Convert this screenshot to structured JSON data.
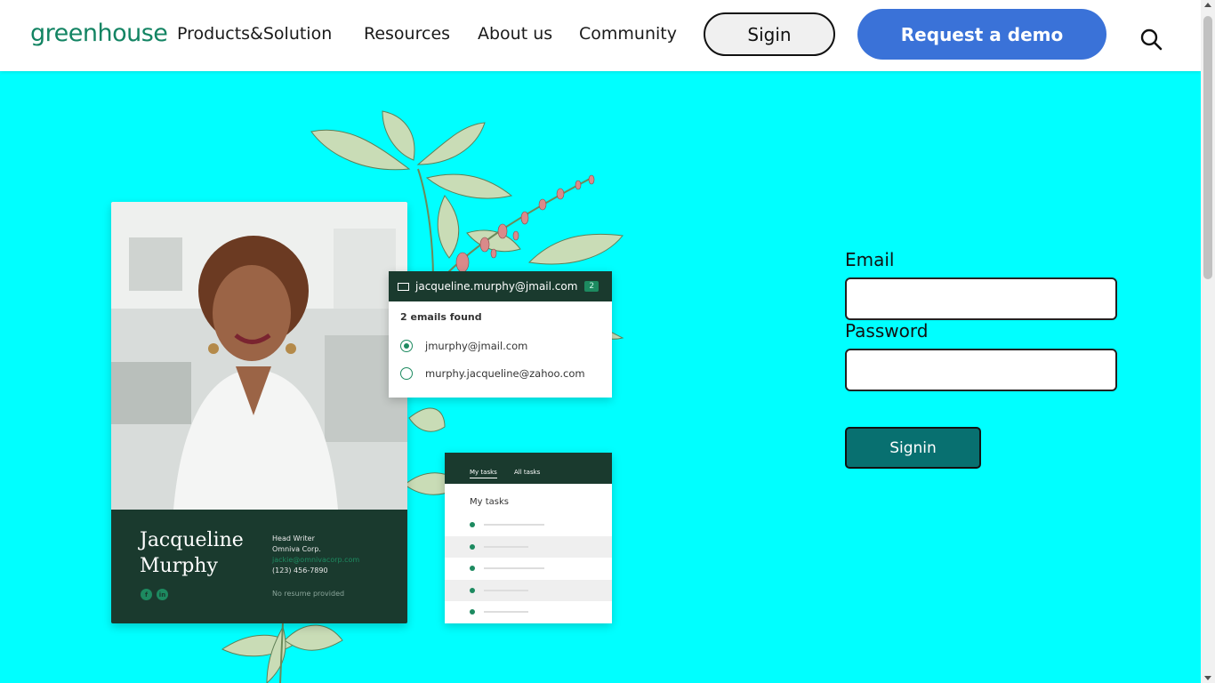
{
  "nav": {
    "logo": "greenhouse",
    "links": [
      "Products&Solution",
      "Resources",
      "About us",
      "Community"
    ],
    "signin_label": "Sigin",
    "demo_label": "Request a demo",
    "search_icon": "search-icon"
  },
  "hero": {
    "profile": {
      "name": "Jacqueline Murphy",
      "role": "Head Writer",
      "company": "Omniva Corp.",
      "email": "jackie@omnivacorp.com",
      "phone": "(123) 456-7890",
      "resume_status": "No resume provided",
      "social_icons": [
        "facebook-icon",
        "linkedin-icon"
      ]
    },
    "email_card": {
      "address": "jacqueline.murphy@jmail.com",
      "count": "2",
      "found_label": "2 emails found",
      "options": [
        "jmurphy@jmail.com",
        "murphy.jacqueline@zahoo.com"
      ],
      "selected_index": 0
    },
    "tasks_card": {
      "tabs": [
        "My tasks",
        "All tasks"
      ],
      "title": "My tasks",
      "row_count": 5
    }
  },
  "form": {
    "email_label": "Email",
    "email_value": "",
    "password_label": "Password",
    "password_value": "",
    "submit_label": "Signin"
  },
  "colors": {
    "background": "#00ffff",
    "brand_green": "#138463",
    "demo_button": "#3a72d8",
    "submit_button": "#087070",
    "card_dark": "#1a3a2e"
  }
}
